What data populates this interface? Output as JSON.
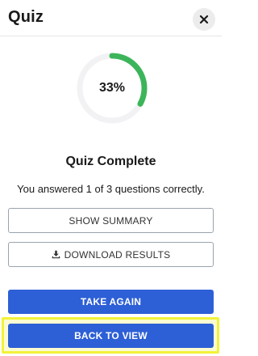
{
  "header": {
    "title": "Quiz",
    "close_icon": "close-icon"
  },
  "result": {
    "percent_label": "33%",
    "progress": 0.33,
    "progress_color": "#3cb55a",
    "track_color": "#f2f2f4",
    "heading": "Quiz Complete",
    "summary": "You answered 1 of 3 questions correctly."
  },
  "actions": {
    "show_summary": "SHOW SUMMARY",
    "download_results": "DOWNLOAD RESULTS",
    "download_icon": "download-icon",
    "take_again": "TAKE AGAIN",
    "back_to_view": "BACK TO VIEW"
  },
  "colors": {
    "primary": "#2d5fd6",
    "highlight": "#f2f23a"
  }
}
